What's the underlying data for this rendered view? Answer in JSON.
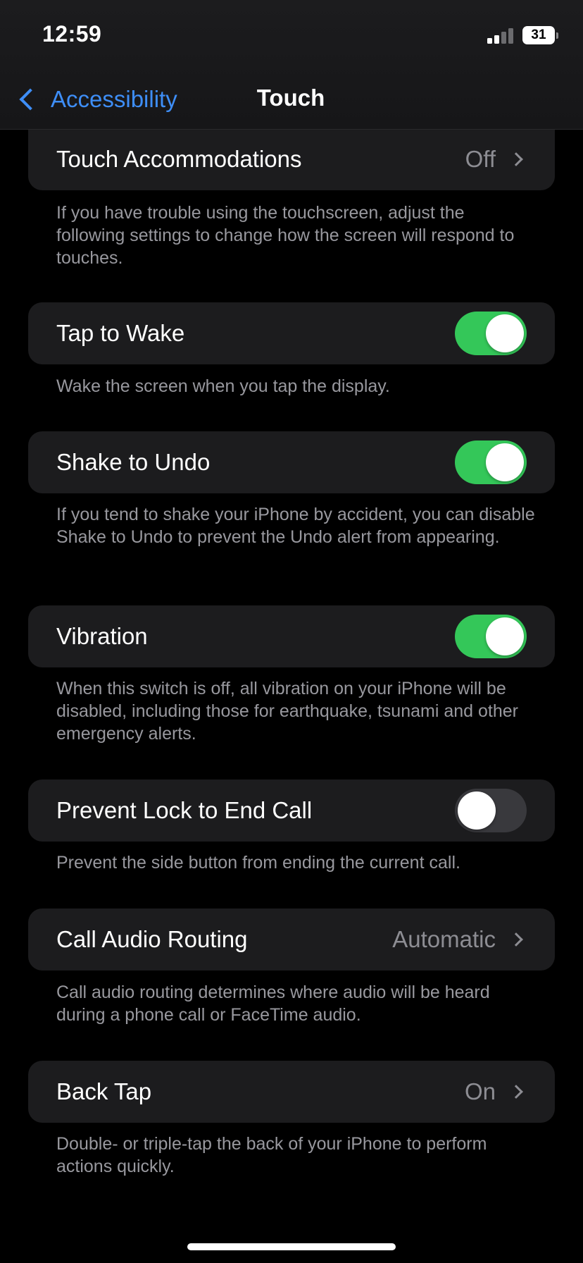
{
  "status_bar": {
    "time": "12:59",
    "battery": "31"
  },
  "nav": {
    "back_label": "Accessibility",
    "title": "Touch"
  },
  "rows": [
    {
      "label": "Touch Accommodations",
      "value": "Off",
      "footer": "If you have trouble using the touchscreen, adjust the following settings to change how the screen will respond to touches."
    },
    {
      "label": "Tap to Wake",
      "toggle": true,
      "footer": "Wake the screen when you tap the display."
    },
    {
      "label": "Shake to Undo",
      "toggle": true,
      "footer": "If you tend to shake your iPhone by accident, you can disable Shake to Undo to prevent the Undo alert from appearing."
    },
    {
      "label": "Vibration",
      "toggle": true,
      "footer": "When this switch is off, all vibration on your iPhone will be disabled, including those for earthquake, tsunami and other emergency alerts."
    },
    {
      "label": "Prevent Lock to End Call",
      "toggle": false,
      "footer": "Prevent the side button from ending the current call."
    },
    {
      "label": "Call Audio Routing",
      "value": "Automatic",
      "footer": "Call audio routing determines where audio will be heard during a phone call or FaceTime audio."
    },
    {
      "label": "Back Tap",
      "value": "On",
      "footer": "Double- or triple-tap the back of your iPhone to perform actions quickly."
    }
  ],
  "colors": {
    "accent": "#3e8ef7",
    "toggle_on": "#34c759",
    "toggle_off": "#39393d",
    "cell_bg": "#1c1c1e"
  }
}
